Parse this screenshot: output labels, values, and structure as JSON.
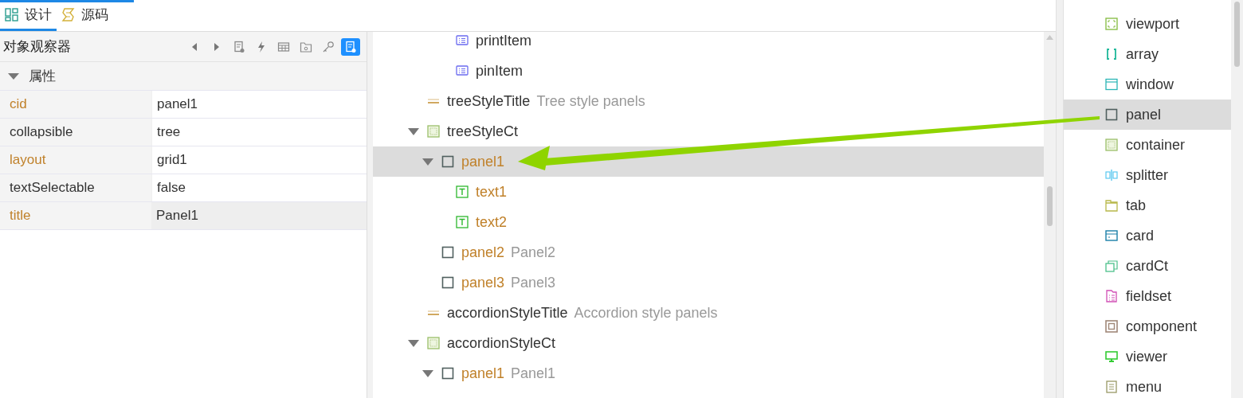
{
  "editor_tabs": [
    {
      "label": "设计",
      "kind": "design",
      "selected": true
    },
    {
      "label": "源码",
      "kind": "source",
      "selected": false
    }
  ],
  "inspector": {
    "title": "对象观察器",
    "toolbar": [
      {
        "kind": "prev",
        "selected": false
      },
      {
        "kind": "next",
        "selected": false
      },
      {
        "kind": "doc",
        "selected": false
      },
      {
        "kind": "bolt",
        "selected": false
      },
      {
        "kind": "table",
        "selected": false
      },
      {
        "kind": "folder",
        "selected": false
      },
      {
        "kind": "key",
        "selected": false
      },
      {
        "kind": "doc",
        "selected": true
      }
    ],
    "section": {
      "label": "属性",
      "expanded": true
    },
    "properties": [
      {
        "name": "cid",
        "value": "panel1",
        "highlighted": true,
        "selected": false
      },
      {
        "name": "collapsible",
        "value": "tree",
        "highlighted": false,
        "selected": false
      },
      {
        "name": "layout",
        "value": "grid1",
        "highlighted": true,
        "selected": false
      },
      {
        "name": "textSelectable",
        "value": "false",
        "highlighted": false,
        "selected": false
      },
      {
        "name": "title",
        "value": "Panel1",
        "highlighted": true,
        "selected": true
      }
    ]
  },
  "tree": {
    "items": [
      {
        "children": [
          {
            "children": [
              {
                "children": [
                  {
                    "kind": "list",
                    "label": "printItem",
                    "selected": false
                  },
                  {
                    "kind": "list",
                    "label": "pinItem",
                    "selected": false
                  }
                ]
              }
            ]
          },
          {
            "kind": "title",
            "label": "treeStyleTitle",
            "caption": "Tree style panels",
            "selected": false
          },
          {
            "kind": "container",
            "label": "treeStyleCt",
            "expanded": true,
            "selected": false,
            "children": [
              {
                "kind": "panel",
                "label": "panel1",
                "expanded": true,
                "selected": true,
                "children": [
                  {
                    "kind": "text",
                    "label": "text1",
                    "selected": false
                  },
                  {
                    "kind": "text",
                    "label": "text2",
                    "selected": false
                  }
                ]
              },
              {
                "kind": "panel",
                "label": "panel2",
                "caption": "Panel2",
                "selected": false
              },
              {
                "kind": "panel",
                "label": "panel3",
                "caption": "Panel3",
                "selected": false
              }
            ]
          },
          {
            "kind": "title",
            "label": "accordionStyleTitle",
            "caption": "Accordion style panels",
            "selected": false
          },
          {
            "kind": "container",
            "label": "accordionStyleCt",
            "expanded": true,
            "selected": false,
            "children": [
              {
                "kind": "panel",
                "label": "panel1",
                "caption": "Panel1",
                "expanded": true,
                "selected": false
              }
            ]
          }
        ]
      }
    ]
  },
  "palette": [
    {
      "kind": "viewport",
      "label": "viewport",
      "selected": false
    },
    {
      "kind": "array",
      "label": "array",
      "selected": false
    },
    {
      "kind": "window",
      "label": "window",
      "selected": false
    },
    {
      "kind": "panel",
      "label": "panel",
      "selected": true
    },
    {
      "kind": "container",
      "label": "container",
      "selected": false
    },
    {
      "kind": "splitter",
      "label": "splitter",
      "selected": false
    },
    {
      "kind": "tab",
      "label": "tab",
      "selected": false
    },
    {
      "kind": "card",
      "label": "card",
      "selected": false
    },
    {
      "kind": "cardCt",
      "label": "cardCt",
      "selected": false
    },
    {
      "kind": "fieldset",
      "label": "fieldset",
      "selected": false
    },
    {
      "kind": "component",
      "label": "component",
      "selected": false
    },
    {
      "kind": "viewer",
      "label": "viewer",
      "selected": false
    },
    {
      "kind": "menu",
      "label": "menu",
      "selected": false
    }
  ],
  "drag_arrow": {
    "kind": "arrow"
  }
}
